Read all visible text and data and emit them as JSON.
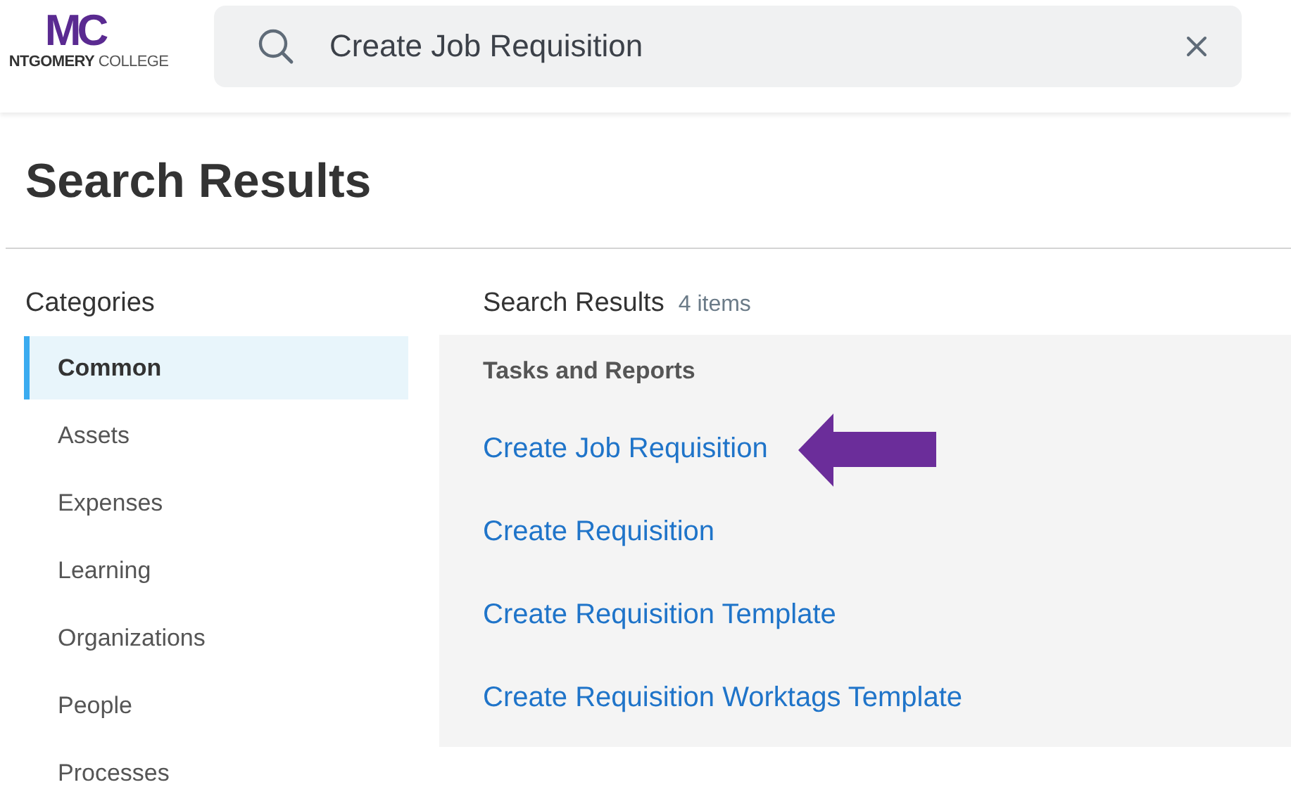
{
  "logo": {
    "mark": "MC",
    "wordmark": "**NTGOMERY** COLLEGE"
  },
  "search": {
    "value": "Create Job Requisition"
  },
  "page_title": "Search Results",
  "categories": {
    "heading": "Categories",
    "items": [
      {
        "label": "Common",
        "selected": true
      },
      {
        "label": "Assets",
        "selected": false
      },
      {
        "label": "Expenses",
        "selected": false
      },
      {
        "label": "Learning",
        "selected": false
      },
      {
        "label": "Organizations",
        "selected": false
      },
      {
        "label": "People",
        "selected": false
      },
      {
        "label": "Processes",
        "selected": false
      }
    ]
  },
  "results": {
    "heading": "Search Results",
    "count": "4 items",
    "group": "Tasks and Reports",
    "items": [
      {
        "label": "Create Job Requisition",
        "pointed_at": true
      },
      {
        "label": "Create Requisition",
        "pointed_at": false
      },
      {
        "label": "Create Requisition Template",
        "pointed_at": false
      },
      {
        "label": "Create Requisition Worktags Template",
        "pointed_at": false
      }
    ]
  }
}
